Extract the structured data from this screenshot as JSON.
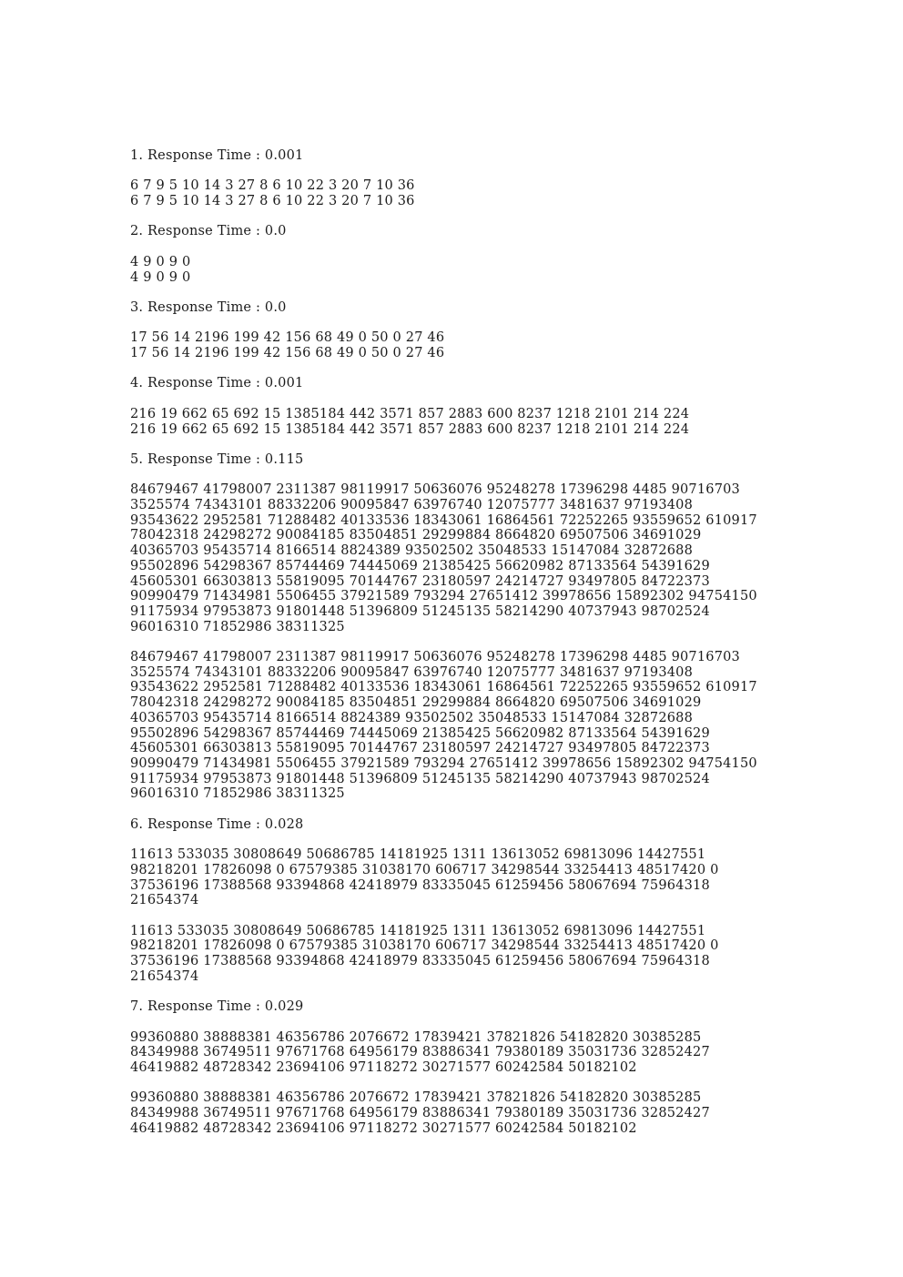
{
  "document": {
    "items": [
      {
        "heading": "1. Response Time : 0.001",
        "blocks": [
          [
            "6 7 9 5 10 14 3 27 8 6 10 22 3 20 7 10 36",
            "6 7 9 5 10 14 3 27 8 6 10 22 3 20 7 10 36"
          ]
        ]
      },
      {
        "heading": "2. Response Time : 0.0",
        "blocks": [
          [
            "4 9 0 9 0",
            "4 9 0 9 0"
          ]
        ]
      },
      {
        "heading": "3. Response Time : 0.0",
        "blocks": [
          [
            "17 56 14 2196 199 42 156 68 49 0 50 0 27 46",
            "17 56 14 2196 199 42 156 68 49 0 50 0 27 46"
          ]
        ]
      },
      {
        "heading": "4. Response Time : 0.001",
        "blocks": [
          [
            "216 19 662 65 692 15 1385184 442 3571 857 2883 600 8237 1218 2101 214 224",
            "216 19 662 65 692 15 1385184 442 3571 857 2883 600 8237 1218 2101 214 224"
          ]
        ]
      },
      {
        "heading": "5. Response Time : 0.115",
        "blocks": [
          [
            "84679467 41798007 2311387 98119917 50636076 95248278 17396298 4485 90716703",
            "3525574 74343101 88332206 90095847 63976740 12075777 3481637 97193408",
            "93543622 2952581 71288482 40133536 18343061 16864561 72252265 93559652 610917",
            "78042318 24298272 90084185 83504851 29299884 8664820 69507506 34691029",
            "40365703 95435714 8166514 8824389 93502502 35048533 15147084 32872688",
            "95502896 54298367 85744469 74445069 21385425 56620982 87133564 54391629",
            "45605301 66303813 55819095 70144767 23180597 24214727 93497805 84722373",
            "90990479 71434981 5506455 37921589 793294 27651412 39978656 15892302 94754150",
            "91175934 97953873 91801448 51396809 51245135 58214290 40737943 98702524",
            "96016310 71852986 38311325"
          ],
          [
            "84679467 41798007 2311387 98119917 50636076 95248278 17396298 4485 90716703",
            "3525574 74343101 88332206 90095847 63976740 12075777 3481637 97193408",
            "93543622 2952581 71288482 40133536 18343061 16864561 72252265 93559652 610917",
            "78042318 24298272 90084185 83504851 29299884 8664820 69507506 34691029",
            "40365703 95435714 8166514 8824389 93502502 35048533 15147084 32872688",
            "95502896 54298367 85744469 74445069 21385425 56620982 87133564 54391629",
            "45605301 66303813 55819095 70144767 23180597 24214727 93497805 84722373",
            "90990479 71434981 5506455 37921589 793294 27651412 39978656 15892302 94754150",
            "91175934 97953873 91801448 51396809 51245135 58214290 40737943 98702524",
            "96016310 71852986 38311325"
          ]
        ]
      },
      {
        "heading": "6. Response Time : 0.028",
        "blocks": [
          [
            "11613 533035 30808649 50686785 14181925 1311 13613052 69813096 14427551",
            "98218201 17826098 0 67579385 31038170 606717 34298544 33254413 48517420 0",
            "37536196 17388568 93394868 42418979 83335045 61259456 58067694 75964318",
            "21654374"
          ],
          [
            "11613 533035 30808649 50686785 14181925 1311 13613052 69813096 14427551",
            "98218201 17826098 0 67579385 31038170 606717 34298544 33254413 48517420 0",
            "37536196 17388568 93394868 42418979 83335045 61259456 58067694 75964318",
            "21654374"
          ]
        ]
      },
      {
        "heading": "7. Response Time : 0.029",
        "blocks": [
          [
            "99360880 38888381 46356786 2076672 17839421 37821826 54182820 30385285",
            "84349988 36749511 97671768 64956179 83886341 79380189 35031736 32852427",
            "46419882 48728342 23694106 97118272 30271577 60242584 50182102"
          ],
          [
            "99360880 38888381 46356786 2076672 17839421 37821826 54182820 30385285",
            "84349988 36749511 97671768 64956179 83886341 79380189 35031736 32852427",
            "46419882 48728342 23694106 97118272 30271577 60242584 50182102"
          ]
        ]
      }
    ]
  }
}
